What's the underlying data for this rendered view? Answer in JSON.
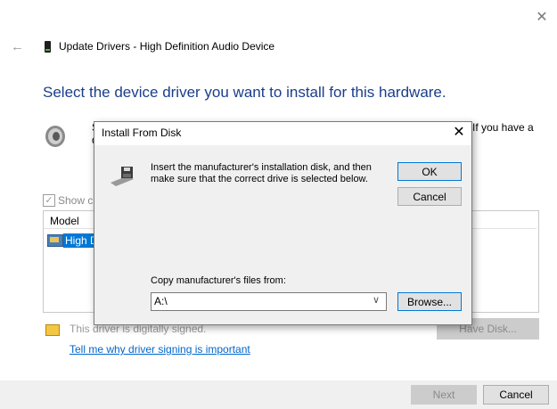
{
  "wizard": {
    "title": "Update Drivers - High Definition Audio Device",
    "heading": "Select the device driver you want to install for this hardware.",
    "description_start": "S",
    "description_mid": "If you have a",
    "description_line2": "d",
    "compat_label": "Show c",
    "model_header": "Model",
    "model_row": "High D",
    "sign_text": "This driver is digitally signed.",
    "sign_link": "Tell me why driver signing is important",
    "have_disk": "Have Disk...",
    "next": "Next",
    "cancel": "Cancel",
    "close_glyph": "✕",
    "back_glyph": "←"
  },
  "dialog": {
    "title": "Install From Disk",
    "close_glyph": "✕",
    "message": "Insert the manufacturer's installation disk, and then make sure that the correct drive is selected below.",
    "ok": "OK",
    "cancel": "Cancel",
    "copy_label": "Copy manufacturer's files from:",
    "path_value": "A:\\",
    "browse": "Browse...",
    "combo_arrow": "∨"
  },
  "colors": {
    "accent": "#0078d7",
    "heading": "#1a3e8c",
    "link": "#0066cc"
  },
  "icons": [
    "back-arrow-icon",
    "device-icon",
    "close-icon",
    "speaker-icon",
    "floppy-disk-icon",
    "driver-icon",
    "signed-driver-icon",
    "chevron-down-icon"
  ]
}
